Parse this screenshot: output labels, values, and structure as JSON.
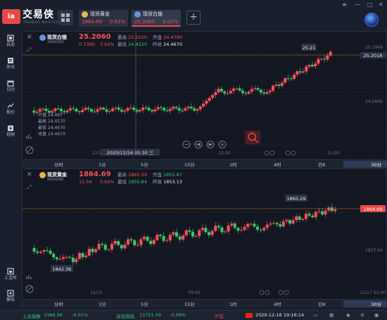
{
  "app": {
    "logo_text": "交易侠",
    "logo_sub": "TRADER MASTER",
    "logo_badge": "ia"
  },
  "tabs": [
    {
      "name": "现货黄金",
      "price": "1864.69",
      "change": "0.62%",
      "coin_color": "#e5b84a"
    },
    {
      "name": "现货白银",
      "price": "25.2060",
      "change": "3.02%",
      "coin_color": "#6a93d9"
    }
  ],
  "window": {
    "plus": "+",
    "menu": "≡",
    "min": "—",
    "max": "□",
    "close": "✕"
  },
  "sidebar": [
    {
      "label": "自选",
      "icon": "star-icon"
    },
    {
      "label": "快讯",
      "icon": "news-icon"
    },
    {
      "label": "日历",
      "icon": "calendar-icon"
    },
    {
      "label": "报价",
      "icon": "quote-icon"
    },
    {
      "label": "视频",
      "icon": "video-icon"
    },
    {
      "label": "上金所",
      "icon": "exchange-icon"
    },
    {
      "label": "模拟",
      "icon": "simulate-icon"
    }
  ],
  "colors": {
    "up": "#f4525a",
    "down": "#3fc66a",
    "accent": "#e94747",
    "bg": "#131722"
  },
  "silver_chart": {
    "name": "现货白银",
    "symbol": "XAGUSD",
    "price": "25.2060",
    "change": "0.7390",
    "pct": "3.02%",
    "high_label": "最高",
    "high": "25.2100",
    "open_label": "开盘",
    "open": "24.4790",
    "low_label": "最低",
    "low": "24.4220",
    "close_label": "昨收",
    "close": "24.4670",
    "cur_price_tag": "25.2018",
    "peak_tag": "25.21",
    "y_top": "25.2949",
    "y_mid": "24.5966",
    "crosshair_time": "2020/12/16 05:30 三",
    "crosshair_day": "12/1",
    "overlay": [
      {
        "label": "开盘",
        "value": "24.487"
      },
      {
        "label": "最高",
        "value": "24.4570"
      },
      {
        "label": "最低",
        "value": "24.4670"
      },
      {
        "label": "收盘",
        "value": "24.4670"
      }
    ],
    "time_labels": [
      "13:00",
      "21:00"
    ]
  },
  "gold_chart": {
    "name": "现货黄金",
    "symbol": "XAUUSD",
    "price": "1864.69",
    "change": "11.56",
    "pct": "0.62%",
    "high_label": "最高",
    "high": "1865.29",
    "open_label": "开盘",
    "open": "1852.87",
    "low_label": "最低",
    "low": "1850.84",
    "close_label": "昨收",
    "close": "1853.13",
    "cur_price_tag": "1864.69",
    "peak_tag": "1865.29",
    "low_tag": "1842.36",
    "y_mid": "1837.94",
    "time_labels": [
      "12/16",
      "09:00",
      "12/17 01:00"
    ]
  },
  "timeframes": [
    "分时",
    "1分",
    "5分",
    "15分",
    "1时",
    "4时",
    "日K",
    "30分"
  ],
  "active_tf": "30分",
  "status": {
    "sh_label": "上证指数",
    "sh_value": "3366.98",
    "sh_chg": "-0.01%",
    "sz_label": "深证成指",
    "sz_value": "13751.09",
    "sz_chg": "-0.09%",
    "cities": "沪弦",
    "datetime": "2020-12-16 19:16:14"
  }
}
